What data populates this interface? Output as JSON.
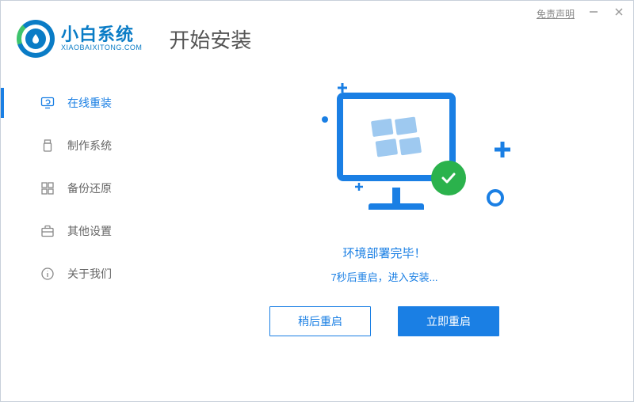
{
  "titlebar": {
    "disclaimer_label": "免责声明"
  },
  "header": {
    "logo_cn": "小白系统",
    "logo_en": "XIAOBAIXITONG.COM",
    "page_title": "开始安装"
  },
  "sidebar": {
    "items": [
      {
        "label": "在线重装"
      },
      {
        "label": "制作系统"
      },
      {
        "label": "备份还原"
      },
      {
        "label": "其他设置"
      },
      {
        "label": "关于我们"
      }
    ]
  },
  "main": {
    "status_text": "环境部署完毕！",
    "substatus_text": "7秒后重启，进入安装...",
    "later_btn": "稍后重启",
    "now_btn": "立即重启"
  }
}
